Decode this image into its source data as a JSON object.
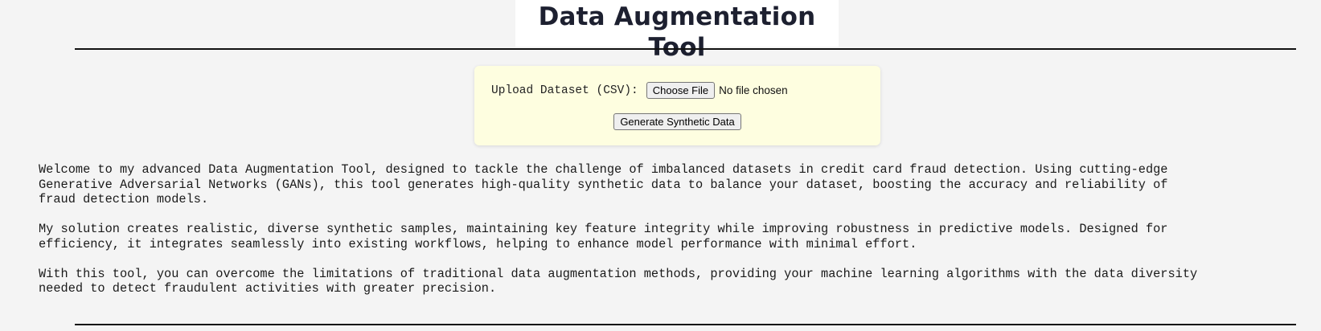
{
  "header": {
    "title": "Data Augmentation Tool"
  },
  "upload_form": {
    "label": "Upload Dataset (CSV):",
    "choose_file_label": "Choose File",
    "file_status": "No file chosen",
    "generate_label": "Generate Synthetic Data"
  },
  "description": {
    "paragraphs": [
      "Welcome to my advanced Data Augmentation Tool, designed to tackle the challenge of imbalanced datasets in credit card fraud detection. Using cutting-edge\nGenerative Adversarial Networks (GANs), this tool generates high-quality synthetic data to balance your dataset, boosting the accuracy and reliability of\nfraud detection models.",
      "My solution creates realistic, diverse synthetic samples, maintaining key feature integrity while improving robustness in predictive models. Designed for\nefficiency, it integrates seamlessly into existing workflows, helping to enhance model performance with minimal effort.",
      "With this tool, you can overcome the limitations of traditional data augmentation methods, providing your machine learning algorithms with the data diversity\nneeded to detect fraudulent activities with greater precision."
    ]
  },
  "colors": {
    "page_background": "#f4f4f4",
    "panel_background": "#fefee0",
    "title_text": "#1d2030"
  }
}
